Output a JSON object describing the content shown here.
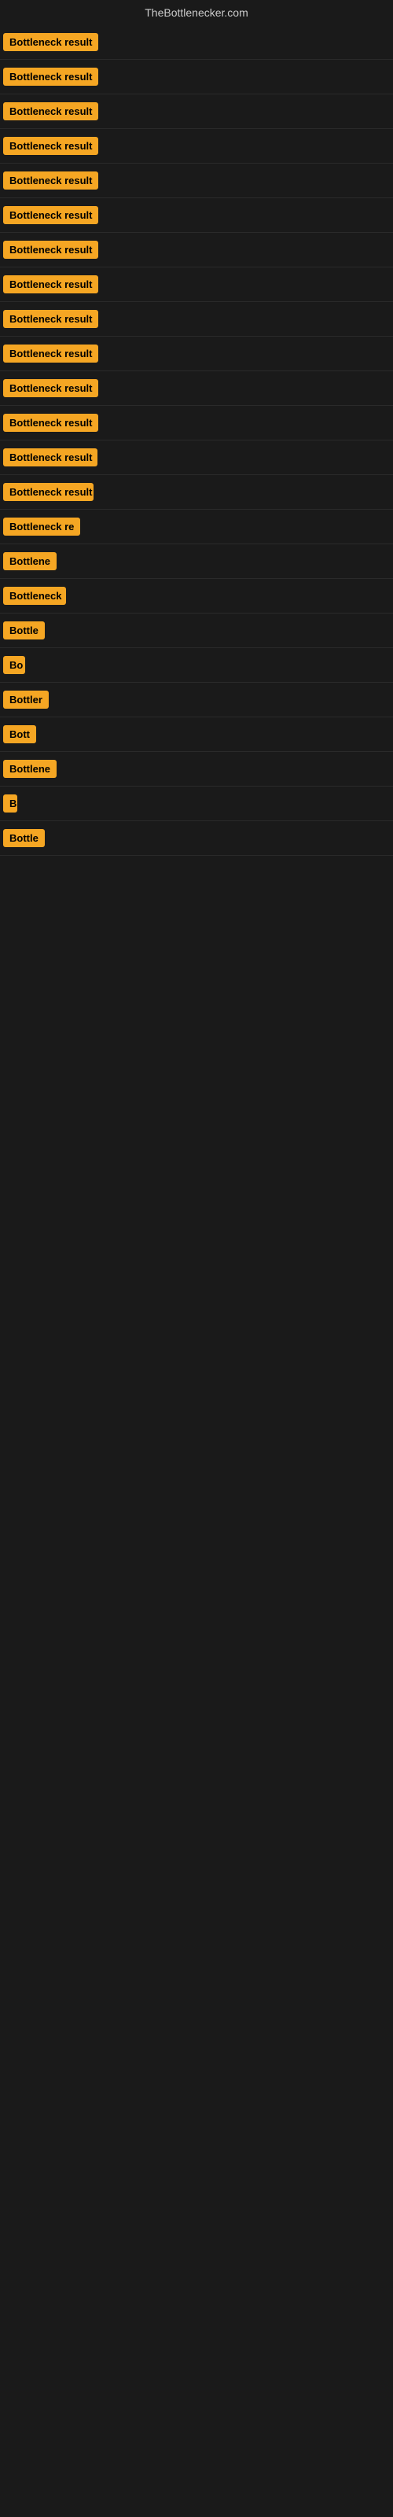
{
  "site": {
    "title": "TheBottlenecker.com"
  },
  "rows": [
    {
      "id": 1,
      "label": "Bottleneck result",
      "width": 130
    },
    {
      "id": 2,
      "label": "Bottleneck result",
      "width": 130
    },
    {
      "id": 3,
      "label": "Bottleneck result",
      "width": 130
    },
    {
      "id": 4,
      "label": "Bottleneck result",
      "width": 130
    },
    {
      "id": 5,
      "label": "Bottleneck result",
      "width": 130
    },
    {
      "id": 6,
      "label": "Bottleneck result",
      "width": 130
    },
    {
      "id": 7,
      "label": "Bottleneck result",
      "width": 130
    },
    {
      "id": 8,
      "label": "Bottleneck result",
      "width": 130
    },
    {
      "id": 9,
      "label": "Bottleneck result",
      "width": 130
    },
    {
      "id": 10,
      "label": "Bottleneck result",
      "width": 130
    },
    {
      "id": 11,
      "label": "Bottleneck result",
      "width": 130
    },
    {
      "id": 12,
      "label": "Bottleneck result",
      "width": 125
    },
    {
      "id": 13,
      "label": "Bottleneck result",
      "width": 120
    },
    {
      "id": 14,
      "label": "Bottleneck result",
      "width": 115
    },
    {
      "id": 15,
      "label": "Bottleneck re",
      "width": 100
    },
    {
      "id": 16,
      "label": "Bottlene",
      "width": 75
    },
    {
      "id": 17,
      "label": "Bottleneck",
      "width": 80
    },
    {
      "id": 18,
      "label": "Bottle",
      "width": 60
    },
    {
      "id": 19,
      "label": "Bo",
      "width": 28
    },
    {
      "id": 20,
      "label": "Bottler",
      "width": 58
    },
    {
      "id": 21,
      "label": "Bott",
      "width": 42
    },
    {
      "id": 22,
      "label": "Bottlene",
      "width": 70
    },
    {
      "id": 23,
      "label": "B",
      "width": 18
    },
    {
      "id": 24,
      "label": "Bottle",
      "width": 55
    }
  ],
  "colors": {
    "badge_bg": "#f5a623",
    "badge_text": "#000000",
    "page_bg": "#1a1a1a",
    "title_color": "#cccccc",
    "divider": "#2a2a2a"
  }
}
